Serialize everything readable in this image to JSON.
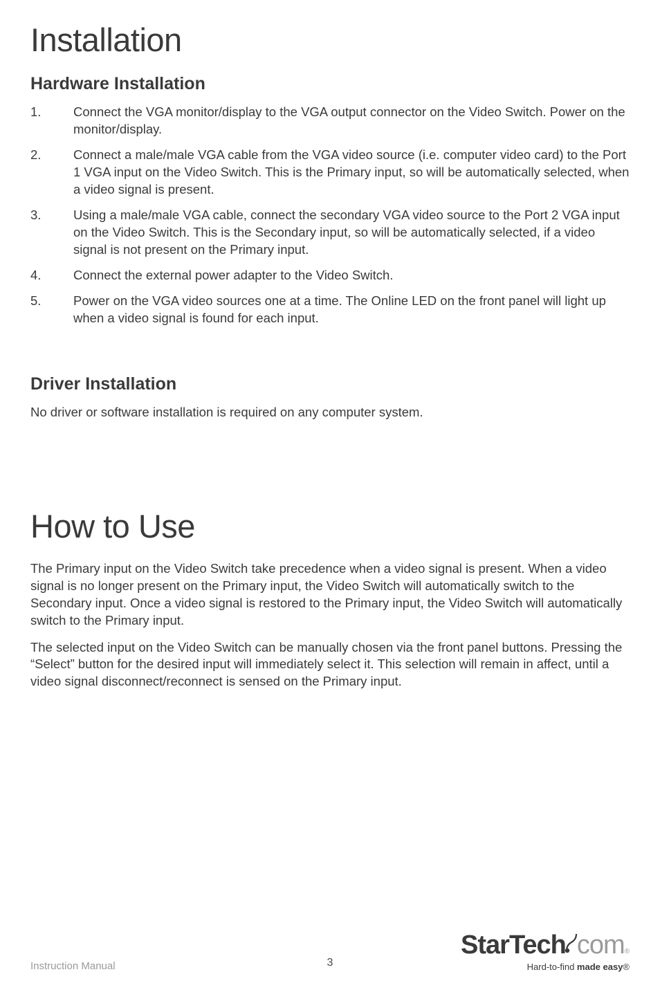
{
  "section1": {
    "title": "Installation",
    "sub1": {
      "title": "Hardware Installation",
      "steps": [
        "Connect the VGA monitor/display to the VGA output connector on the Video Switch.  Power on the monitor/display.",
        "Connect a male/male VGA cable from the VGA video source (i.e. computer video card) to the Port 1 VGA input on the Video Switch.  This is the Primary input, so will be automatically selected, when a video signal is present.",
        "Using a male/male VGA cable, connect the secondary VGA video source to the Port 2 VGA input on the Video Switch.  This is the Secondary input, so will be automatically selected, if a video signal is not present on the Primary input.",
        "Connect the external power adapter to the Video Switch.",
        "Power on the VGA video sources one at a time.  The Online LED on the front panel will light up when a video signal is found for each input."
      ]
    },
    "sub2": {
      "title": "Driver Installation",
      "body": "No driver or software installation is required on any computer system."
    }
  },
  "section2": {
    "title": "How to Use",
    "p1": "The Primary input on the Video Switch take precedence when a video signal is present.  When a video signal is no longer present on the Primary input, the Video Switch will automatically switch to the Secondary input.  Once a video signal is restored to the Primary input, the Video Switch will automatically switch to the Primary input.",
    "p2": "The selected input on the Video Switch can be manually chosen via the front panel buttons.  Pressing the “Select” button for the desired input will immediately select it. This selection will remain in affect, until a video signal disconnect/reconnect is sensed on the Primary input."
  },
  "footer": {
    "left": "Instruction Manual",
    "page": "3",
    "logo_bold": "StarTech",
    "logo_light": "com",
    "tagline_prefix": "Hard-to-find ",
    "tagline_bold": "made easy",
    "reg": "®"
  }
}
